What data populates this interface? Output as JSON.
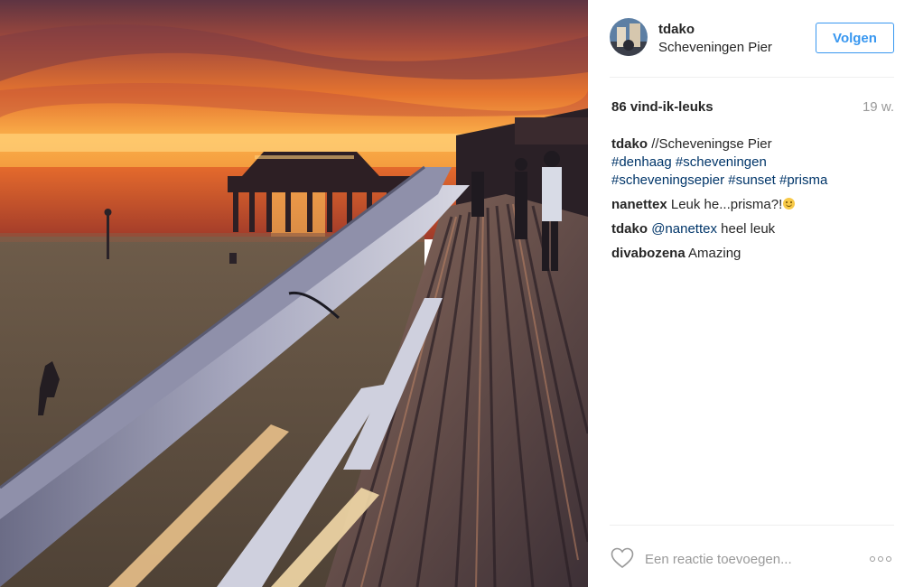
{
  "post": {
    "username": "tdako",
    "location": "Scheveningen Pier",
    "follow_label": "Volgen",
    "likes": "86 vind-ik-leuks",
    "timestamp": "19 w."
  },
  "comments": [
    {
      "author": "tdako",
      "text": "//Scheveningse Pier",
      "tags": [
        "#denhaag",
        "#scheveningen",
        "#scheveningsepier",
        "#sunset",
        "#prisma"
      ]
    },
    {
      "author": "nanettex",
      "text": "Leuk he...prisma?!",
      "emoji": "smiling-face"
    },
    {
      "author": "tdako",
      "mention": "@nanettex",
      "text": "heel leuk"
    },
    {
      "author": "divabozena",
      "text": "Amazing"
    }
  ],
  "footer": {
    "comment_placeholder": "Een reactie toevoegen..."
  },
  "colors": {
    "link": "#003569",
    "follow": "#3897f0",
    "muted": "#999999"
  },
  "icons": {
    "like": "heart-icon",
    "options": "more-options-icon"
  }
}
